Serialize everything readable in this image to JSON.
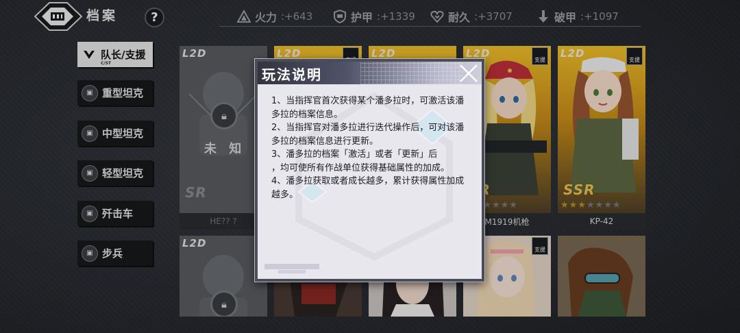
{
  "header": {
    "title": "档案",
    "help_label": "?"
  },
  "stats": [
    {
      "label": "火力",
      "value": ":+643",
      "icon": "firepower-icon"
    },
    {
      "label": "护甲",
      "value": ":+1339",
      "icon": "armor-icon"
    },
    {
      "label": "耐久",
      "value": ":+3707",
      "icon": "durability-icon"
    },
    {
      "label": "破甲",
      "value": ":+1097",
      "icon": "armor-piercing-icon"
    }
  ],
  "tabs": [
    {
      "label": "队长/支援",
      "sub": "C/ST",
      "active": true
    },
    {
      "label": "重型坦克",
      "active": false
    },
    {
      "label": "中型坦克",
      "active": false
    },
    {
      "label": "轻型坦克",
      "active": false
    },
    {
      "label": "歼击车",
      "active": false
    },
    {
      "label": "步兵",
      "active": false
    }
  ],
  "cards": [
    {
      "l2d": "L2D",
      "name": "HE?? ?",
      "unknown_label": "未 知",
      "locked": true,
      "rank": "SR"
    },
    {
      "l2d": "L2D",
      "badge": "支援"
    },
    {
      "l2d": "L2D"
    },
    {
      "l2d": "L2D",
      "badge": "支援",
      "name": "M1919机枪",
      "rank": "SR"
    },
    {
      "l2d": "L2D",
      "badge": "支援",
      "name": "KP-42",
      "rank": "SSR",
      "stars_filled": 3,
      "stars_total": 7
    },
    {
      "l2d": "L2D",
      "locked": true
    },
    {
      "badge": "支援"
    },
    {
      "badge": "支援"
    }
  ],
  "dialog": {
    "title": "玩法说明",
    "lines": [
      "1、当指挥官首次获得某个潘多拉时，可激活该潘多拉的档案信息。",
      "2、当指挥官对潘多拉进行迭代操作后，可对该潘多拉的档案信息进行更新。",
      "3、潘多拉的档案「激活」或者「更新」后",
      "，均可使所有作战单位获得基础属性的加成。",
      "4、潘多拉获取或者成长越多，累计获得属性加成越多。"
    ]
  },
  "colors": {
    "gold": "#e9c45a",
    "dialog_bg": "#e9e7ee",
    "tab_active_bg": "#e9e9eb"
  }
}
